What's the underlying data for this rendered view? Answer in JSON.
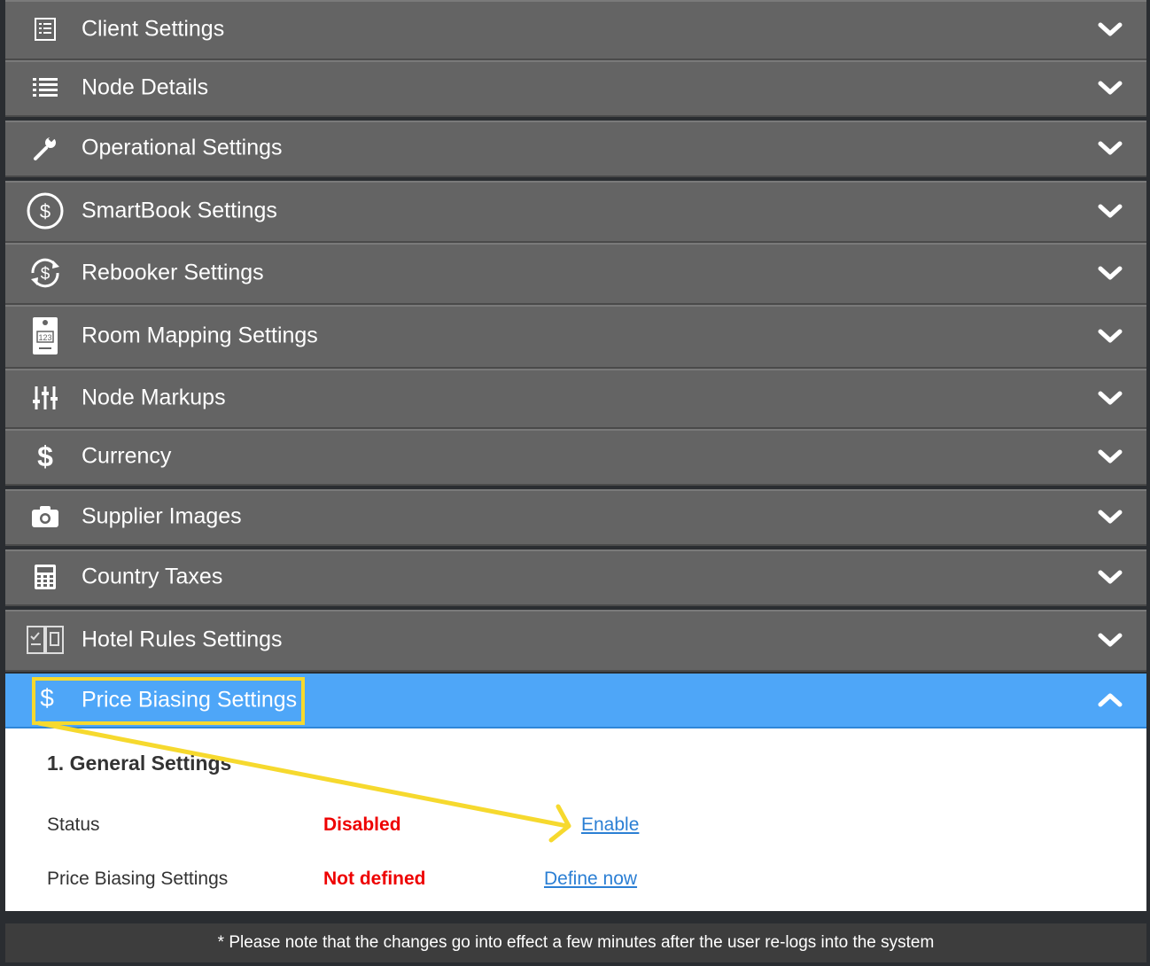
{
  "sections": [
    {
      "label": "Client Settings",
      "icon": "list-document-icon"
    },
    {
      "label": "Node Details",
      "icon": "bulleted-list-icon"
    },
    {
      "label": "Operational Settings",
      "icon": "wrench-icon"
    },
    {
      "label": "SmartBook Settings",
      "icon": "dollar-circle-icon"
    },
    {
      "label": "Rebooker Settings",
      "icon": "dollar-refresh-icon"
    },
    {
      "label": "Room Mapping Settings",
      "icon": "room-tag-icon"
    },
    {
      "label": "Node Markups",
      "icon": "sliders-icon"
    },
    {
      "label": "Currency",
      "icon": "dollar-icon"
    },
    {
      "label": "Supplier Images",
      "icon": "camera-icon"
    },
    {
      "label": "Country Taxes",
      "icon": "calculator-icon"
    },
    {
      "label": "Hotel Rules Settings",
      "icon": "rulebook-icon"
    },
    {
      "label": "Price Biasing Settings",
      "icon": "dollar-icon"
    }
  ],
  "panel": {
    "section_title": "1. General Settings",
    "rows": [
      {
        "label": "Status",
        "value": "Disabled",
        "action": "Enable"
      },
      {
        "label": "Price Biasing Settings",
        "value": "Not defined",
        "action": "Define now"
      }
    ]
  },
  "footer_note": "* Please note that the changes go into effect a few minutes after the user re-logs into the system",
  "colors": {
    "header_bg": "#646464",
    "active_bg": "#4ea6f8",
    "status_red": "#ee0000",
    "link_blue": "#2b7fd4",
    "annotation_yellow": "#f6d92e"
  }
}
